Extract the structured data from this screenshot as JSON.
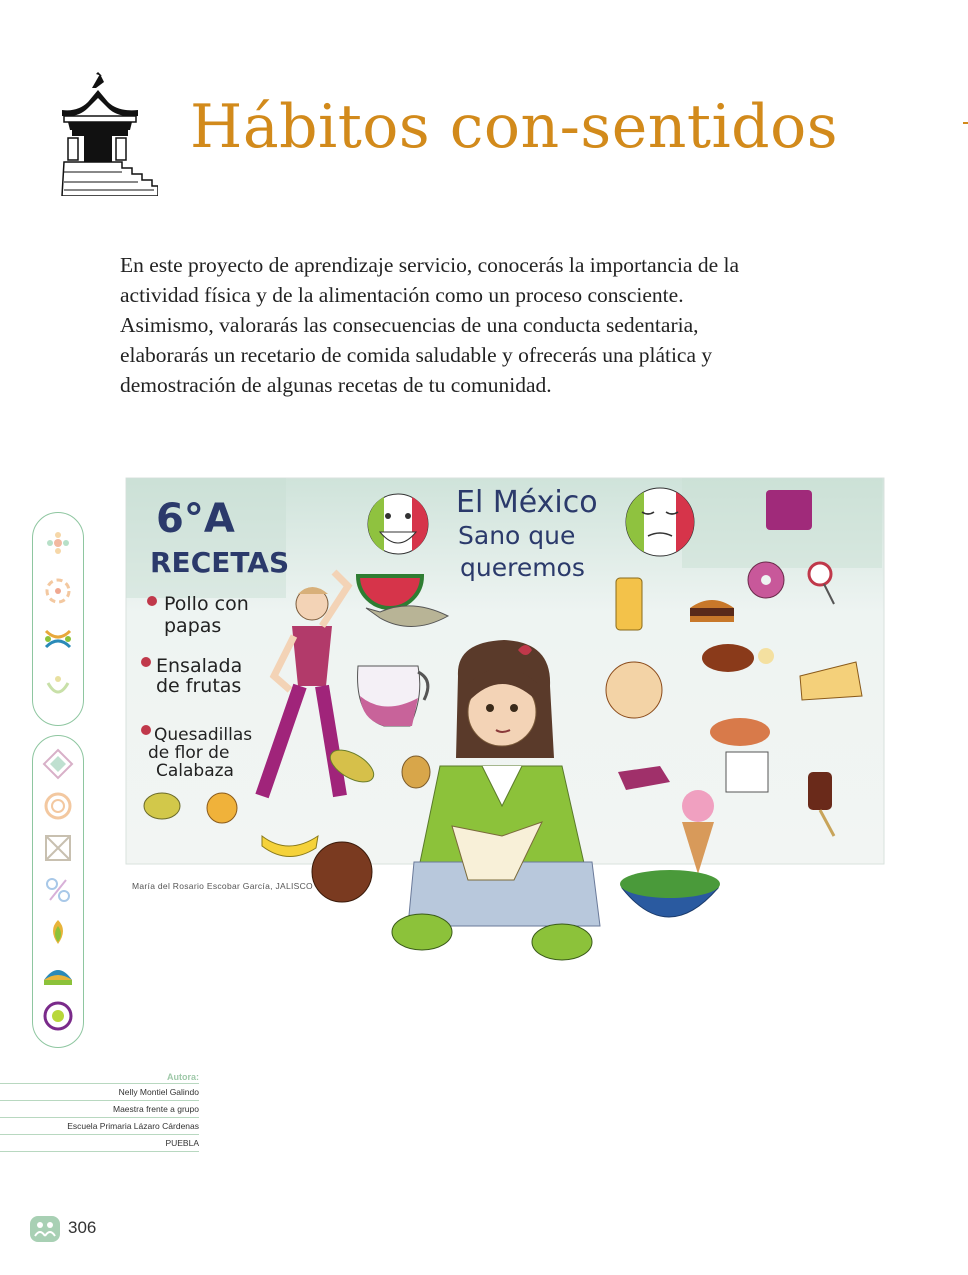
{
  "header": {
    "icon": "kiosk-pavilion-icon",
    "title": "Hábitos con-sentidos"
  },
  "intro": {
    "text": "En este proyecto de aprendizaje servicio, conocerás la importancia de la actividad física y de la alimentación como un proceso consciente. Asimismo, valorarás las consecuencias de una conducta sedentaria, elaborarás un recetario de comida saludable y ofrecerás una plática y demostración de algunas recetas de tu comunidad."
  },
  "artwork": {
    "board_heading": "6°A",
    "board_subheading": "RECETAS",
    "recipes": [
      "Pollo con",
      "papas",
      "Ensalada",
      "de frutas",
      "Quesadillas",
      "de flor de",
      "Calabaza"
    ],
    "board_title_line1": "El México",
    "board_title_line2": "Sano que",
    "board_title_line3": "queremos",
    "caption_name": "María del Rosario Escobar García,",
    "caption_state": "JALISCO"
  },
  "sidebar": {
    "top_icons": [
      "flower-dots-icon",
      "people-circle-icon",
      "linked-rings-icon",
      "person-leaf-icon"
    ],
    "bottom_icons": [
      "diamond-pattern-icon",
      "spiral-icon",
      "square-x-icon",
      "percent-rings-icon",
      "lotus-icon",
      "fan-icon",
      "target-circle-icon"
    ]
  },
  "author": {
    "label": "Autora:",
    "name": "Nelly Montiel Galindo",
    "role": "Maestra frente a grupo",
    "school": "Escuela Primaria Lázaro Cárdenas",
    "state": "PUEBLA"
  },
  "footer": {
    "page_icon": "community-people-icon",
    "page_number": "306"
  },
  "colors": {
    "title": "#d28a1b",
    "sidebar_border": "#8ec6a0",
    "author_label": "#9fc9a9"
  }
}
